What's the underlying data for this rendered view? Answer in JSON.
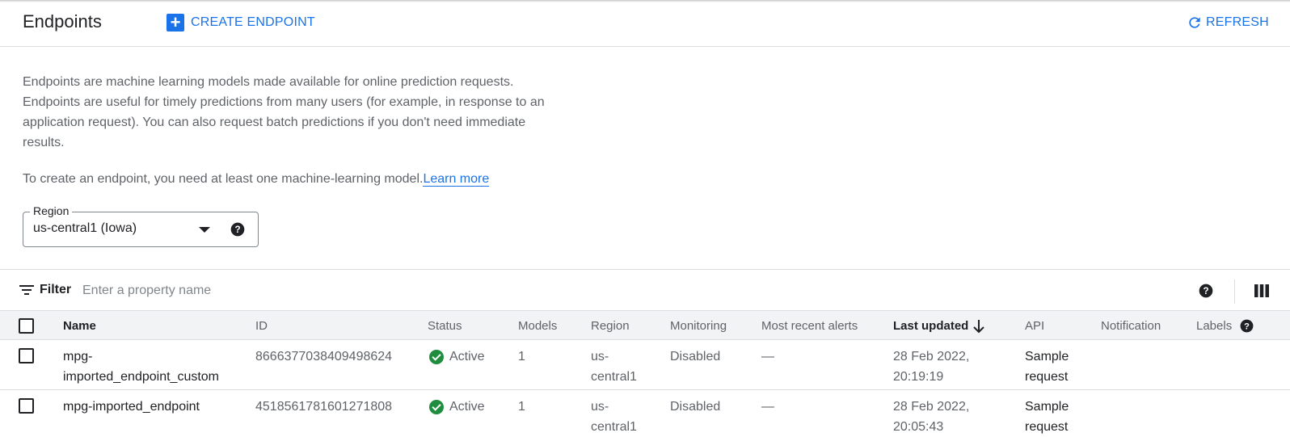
{
  "header": {
    "title": "Endpoints",
    "create_label": "CREATE ENDPOINT",
    "refresh_label": "REFRESH"
  },
  "description": {
    "paragraph1": "Endpoints are machine learning models made available for online prediction requests. Endpoints are useful for timely predictions from many users (for example, in response to an application request). You can also request batch predictions if you don't need immediate results.",
    "paragraph2": "To create an endpoint, you need at least one machine-learning model.",
    "learn_more": "Learn more"
  },
  "region": {
    "label": "Region",
    "value": "us-central1 (Iowa)"
  },
  "filter": {
    "label": "Filter",
    "placeholder": "Enter a property name"
  },
  "table": {
    "columns": {
      "name": "Name",
      "id": "ID",
      "status": "Status",
      "models": "Models",
      "region": "Region",
      "monitoring": "Monitoring",
      "alerts": "Most recent alerts",
      "last_updated": "Last updated",
      "api": "API",
      "notification": "Notification",
      "labels": "Labels"
    },
    "sort": "descending",
    "rows": [
      {
        "name1": "mpg-",
        "name2": "imported_endpoint_custom",
        "id": "8666377038409498624",
        "status": "Active",
        "models": "1",
        "region1": "us-",
        "region2": "central1",
        "monitoring": "Disabled",
        "alerts": "—",
        "updated1": "28 Feb 2022,",
        "updated2": "20:19:19",
        "api1": "Sample",
        "api2": "request"
      },
      {
        "name1": "mpg-imported_endpoint",
        "name2": "",
        "id": "4518561781601271808",
        "status": "Active",
        "models": "1",
        "region1": "us-",
        "region2": "central1",
        "monitoring": "Disabled",
        "alerts": "—",
        "updated1": "28 Feb 2022,",
        "updated2": "20:05:43",
        "api1": "Sample",
        "api2": "request"
      }
    ]
  },
  "colors": {
    "accent": "#1a73e8",
    "active_status": "#1e8e3e",
    "header_bg": "#f1f3f4"
  }
}
